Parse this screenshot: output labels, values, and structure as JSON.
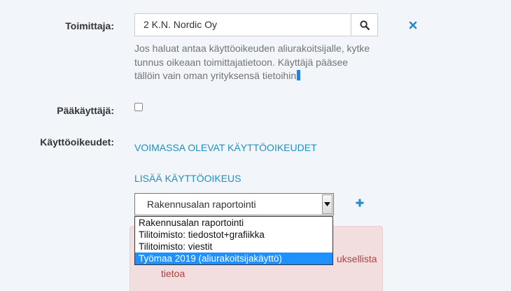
{
  "supplier": {
    "label": "Toimittaja:",
    "value": "2 K.N. Nordic Oy",
    "help": "Jos haluat antaa käyttöoikeuden aliurakoitsijalle, kytke tunnus oikeaan toimittajatietoon. Käyttäjä pääsee tällöin vain oman yrityksensä tietoihin"
  },
  "admin": {
    "label": "Pääkäyttäjä:",
    "checked": false
  },
  "rights": {
    "label": "Käyttöoikeudet:",
    "current_link": "VOIMASSA OLEVAT KÄYTTÖOIKEUDET",
    "add_link": "LISÄÄ KÄYTTÖOIKEUS",
    "select_value": "Rakennusalan raportointi",
    "options": [
      "Rakennusalan raportointi",
      "Tilitoimisto: tiedostot+grafiikka",
      "Tilitoimisto: viestit",
      "Työmaa 2019 (aliurakoitsijakäyttö)"
    ],
    "highlighted_option": "Työmaa 2019 (aliurakoitsijakäyttö)"
  },
  "alert": {
    "text_tail": "uksellista",
    "text_line2": "tietoa"
  },
  "icons": {
    "search": "search-icon",
    "clear": "close-icon",
    "add": "plus-icon",
    "dropdown": "chevron-down-icon"
  },
  "colors": {
    "link": "#1f8fc2",
    "alert_bg": "#f2dede",
    "alert_text": "#a94442",
    "highlight": "#1e90ff"
  }
}
